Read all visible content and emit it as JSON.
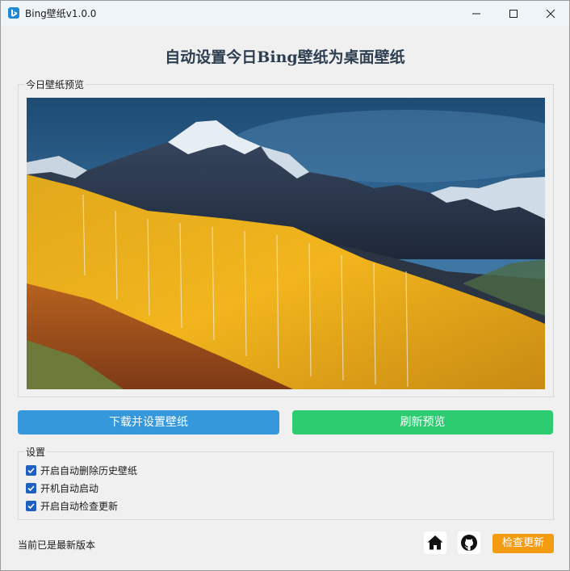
{
  "window": {
    "title": "Bing壁纸v1.0.0",
    "controls": {
      "minimize": "minimize-icon",
      "maximize": "maximize-icon",
      "close": "close-icon"
    }
  },
  "heading": "自动设置今日Bing壁纸为桌面壁纸",
  "preview": {
    "group_label": "今日壁纸预览",
    "image": "autumn-aspen-mountain-landscape"
  },
  "actions": {
    "download_label": "下载并设置壁纸",
    "refresh_label": "刷新预览",
    "download_color": "#3498db",
    "refresh_color": "#2ecc71"
  },
  "settings": {
    "group_label": "设置",
    "options": [
      {
        "label": "开启自动删除历史壁纸",
        "checked": true
      },
      {
        "label": "开机自动启动",
        "checked": true
      },
      {
        "label": "开启自动检查更新",
        "checked": true
      }
    ]
  },
  "footer": {
    "status": "当前已是最新版本",
    "home_icon": "home-icon",
    "github_icon": "github-icon",
    "check_update_label": "检查更新",
    "check_update_color": "#f39c12"
  }
}
